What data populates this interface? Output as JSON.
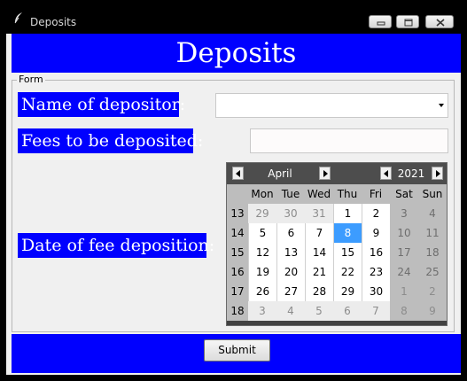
{
  "window": {
    "title": "Deposits"
  },
  "header": {
    "title": "Deposits"
  },
  "form": {
    "legend": "Form",
    "name_label": "Name of depositor:",
    "name_value": "",
    "fees_label": "Fees to be deposited:",
    "fees_value": "",
    "date_label": "Date of fee deposition:"
  },
  "calendar": {
    "month": "April",
    "year": "2021",
    "day_headers": [
      "Mon",
      "Tue",
      "Wed",
      "Thu",
      "Fri",
      "Sat",
      "Sun"
    ],
    "selected_day": "8",
    "weeks": [
      {
        "num": "13",
        "days": [
          "29",
          "30",
          "31",
          "1",
          "2",
          "3",
          "4"
        ]
      },
      {
        "num": "14",
        "days": [
          "5",
          "6",
          "7",
          "8",
          "9",
          "10",
          "11"
        ]
      },
      {
        "num": "15",
        "days": [
          "12",
          "13",
          "14",
          "15",
          "16",
          "17",
          "18"
        ]
      },
      {
        "num": "16",
        "days": [
          "19",
          "20",
          "21",
          "22",
          "23",
          "24",
          "25"
        ]
      },
      {
        "num": "17",
        "days": [
          "26",
          "27",
          "28",
          "29",
          "30",
          "1",
          "2"
        ]
      },
      {
        "num": "18",
        "days": [
          "3",
          "4",
          "5",
          "6",
          "7",
          "8",
          "9"
        ]
      }
    ],
    "in_month": [
      [
        false,
        false,
        false,
        true,
        true,
        true,
        true
      ],
      [
        true,
        true,
        true,
        true,
        true,
        true,
        true
      ],
      [
        true,
        true,
        true,
        true,
        true,
        true,
        true
      ],
      [
        true,
        true,
        true,
        true,
        true,
        true,
        true
      ],
      [
        true,
        true,
        true,
        true,
        true,
        false,
        false
      ],
      [
        false,
        false,
        false,
        false,
        false,
        false,
        false
      ]
    ],
    "colors": {
      "header_bg": "#424242",
      "selected": "#3c9cff",
      "weekend": "#bdbdbd"
    }
  },
  "footer": {
    "submit_label": "Submit"
  },
  "colors": {
    "accent_blue": "#0000ff",
    "window_bg": "#f0f0f0"
  },
  "icons": [
    "feather-icon",
    "minimize-icon",
    "maximize-icon",
    "close-icon",
    "chevron-down-icon",
    "arrow-left-icon",
    "arrow-right-icon"
  ]
}
